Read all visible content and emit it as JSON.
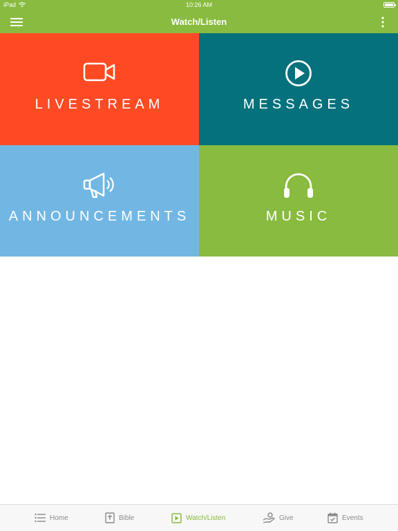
{
  "status_bar": {
    "carrier": "iPad",
    "time": "10:26 AM"
  },
  "navbar": {
    "title": "Watch/Listen",
    "menu_icon": "hamburger-icon",
    "more_icon": "more-vertical-icon"
  },
  "tiles": [
    {
      "label": "LIVESTREAM",
      "icon": "video-camera-icon",
      "color": "#ff4a24"
    },
    {
      "label": "MESSAGES",
      "icon": "play-circle-icon",
      "color": "#05717d"
    },
    {
      "label": "ANNOUNCEMENTS",
      "icon": "megaphone-icon",
      "color": "#72b7e4"
    },
    {
      "label": "MUSIC",
      "icon": "headphones-icon",
      "color": "#88bb3f"
    }
  ],
  "tabbar": {
    "items": [
      {
        "label": "Home",
        "icon": "list-icon"
      },
      {
        "label": "Bible",
        "icon": "bible-icon"
      },
      {
        "label": "Watch/Listen",
        "icon": "play-square-icon",
        "active": true
      },
      {
        "label": "Give",
        "icon": "give-hand-icon"
      },
      {
        "label": "Events",
        "icon": "calendar-icon"
      }
    ]
  },
  "colors": {
    "accent": "#88bb3f",
    "tab_inactive": "#8a8a8a"
  }
}
